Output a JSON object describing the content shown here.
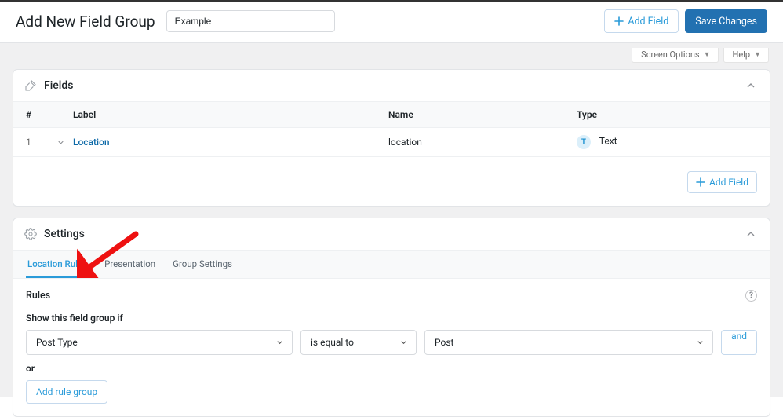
{
  "header": {
    "page_title": "Add New Field Group",
    "title_input_value": "Example",
    "add_field_label": "Add Field",
    "save_label": "Save Changes"
  },
  "wp_dd": {
    "screen_options": "Screen Options",
    "help": "Help"
  },
  "fields_panel": {
    "title": "Fields",
    "columns": {
      "num": "#",
      "label": "Label",
      "name": "Name",
      "type": "Type"
    },
    "rows": [
      {
        "num": "1",
        "label": "Location",
        "name": "location",
        "type_badge": "T",
        "type_label": "Text"
      }
    ],
    "add_field_label": "Add Field"
  },
  "settings_panel": {
    "title": "Settings",
    "tabs": {
      "location_rules": "Location Rules",
      "presentation": "Presentation",
      "group_settings": "Group Settings"
    },
    "rules_title": "Rules",
    "help_glyph": "?",
    "rules_sub": "Show this field group if",
    "rule": {
      "param": "Post Type",
      "operator": "is equal to",
      "value": "Post"
    },
    "and_label": "and",
    "or_label": "or",
    "add_rule_group": "Add rule group"
  }
}
